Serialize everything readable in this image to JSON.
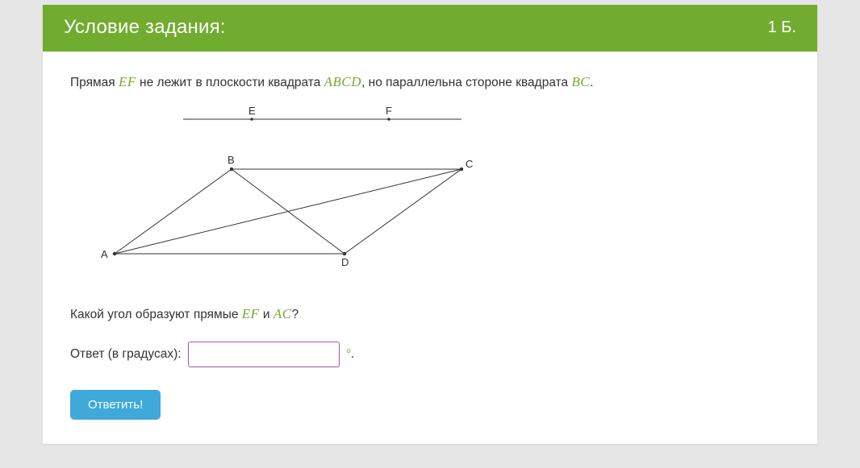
{
  "header": {
    "title": "Условие задания:",
    "points": "1 Б."
  },
  "problem": {
    "line1_a": "Прямая ",
    "line1_ef": "EF",
    "line1_b": " не лежит в плоскости квадрата ",
    "line1_abcd": "ABCD",
    "line1_c": ", но параллельна стороне квадрата ",
    "line1_bc": "BC",
    "line1_d": "."
  },
  "figure": {
    "labels": {
      "A": "A",
      "B": "B",
      "C": "C",
      "D": "D",
      "E": "E",
      "F": "F"
    }
  },
  "question": {
    "q_a": "Какой угол образуют прямые ",
    "q_ef": "EF",
    "q_b": " и ",
    "q_ac": "AC",
    "q_c": "?"
  },
  "answer": {
    "label": "Ответ (в градусах):",
    "value": "",
    "degree": "°",
    "dot": "."
  },
  "submit": {
    "label": "Ответить!"
  }
}
